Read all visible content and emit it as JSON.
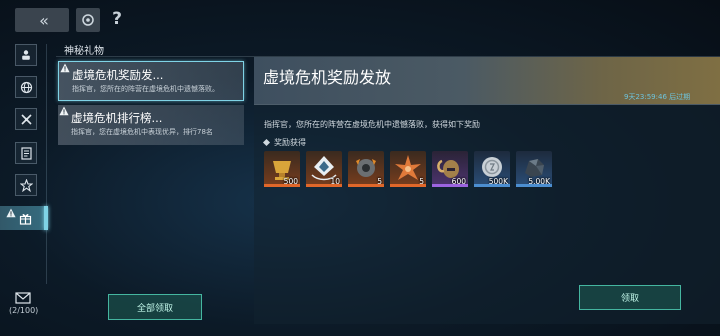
{
  "top_bar": {
    "back_label": "«",
    "help_label": "?"
  },
  "section": {
    "title": "神秘礼物"
  },
  "messages": [
    {
      "title": "虚境危机奖励发...",
      "subtitle": "指挥官，您所在的阵营在虚境危机中遗憾落败。"
    },
    {
      "title": "虚境危机排行榜...",
      "subtitle": "指挥官，您在虚境危机中表现优异，排行78名"
    }
  ],
  "claim_all_label": "全部领取",
  "mail": {
    "count": "(2/100)"
  },
  "detail": {
    "title": "虚境危机奖励发放",
    "expire": "9天23:59:46 后过期",
    "body": "指挥官，您所在的阵营在虚境危机中遗憾落败，获得如下奖励",
    "reward_label": "奖励获得",
    "items": [
      {
        "icon": "golden-cup-icon",
        "count": "500",
        "rarity": "orange"
      },
      {
        "icon": "crystal-emblem-icon",
        "count": "10",
        "rarity": "orange"
      },
      {
        "icon": "gear-helmet-icon",
        "count": "5",
        "rarity": "orange"
      },
      {
        "icon": "star-burst-icon",
        "count": "5",
        "rarity": "orange"
      },
      {
        "icon": "ram-helmet-icon",
        "count": "600",
        "rarity": "purple"
      },
      {
        "icon": "silver-coin-icon",
        "count": "500K",
        "rarity": "blue"
      },
      {
        "icon": "ore-chunk-icon",
        "count": "5.00K",
        "rarity": "blue"
      }
    ],
    "claim_label": "领取"
  },
  "colors": {
    "accent": "#7fd3e6",
    "button_border": "#45b6a0",
    "expire_text": "#6ec3dc"
  }
}
